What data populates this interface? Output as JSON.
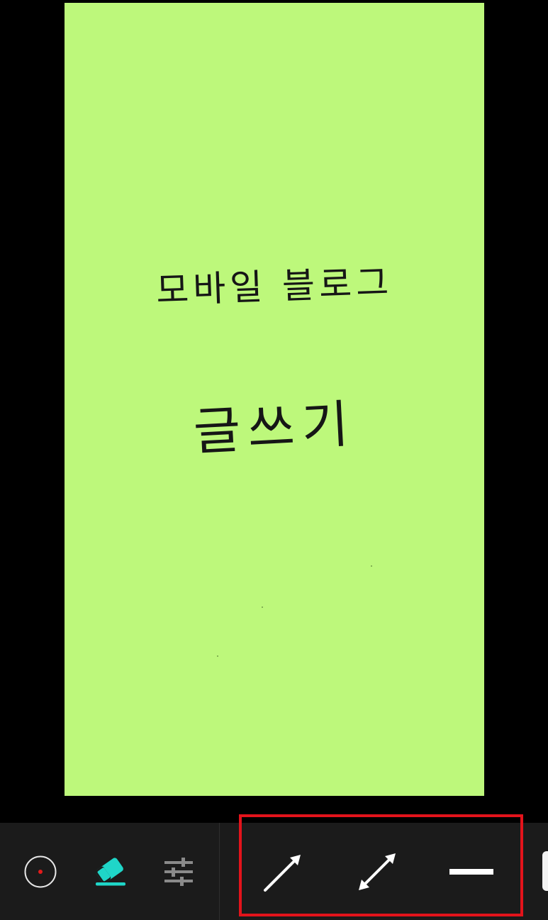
{
  "canvas": {
    "paper_color": "#bdf87b",
    "handwriting": {
      "line1": "모바일 블로그",
      "line2": "글쓰기"
    }
  },
  "toolbar": {
    "tools": [
      {
        "name": "pen-color-icon",
        "color": "#e21b1b"
      },
      {
        "name": "eraser-icon",
        "color": "#1fd6c8"
      },
      {
        "name": "settings-sliders-icon",
        "color": "#8a8a8a"
      }
    ],
    "line_styles": [
      {
        "name": "single-arrow-icon"
      },
      {
        "name": "double-arrow-icon"
      },
      {
        "name": "straight-line-icon"
      }
    ],
    "highlight_color": "#e3131b"
  }
}
